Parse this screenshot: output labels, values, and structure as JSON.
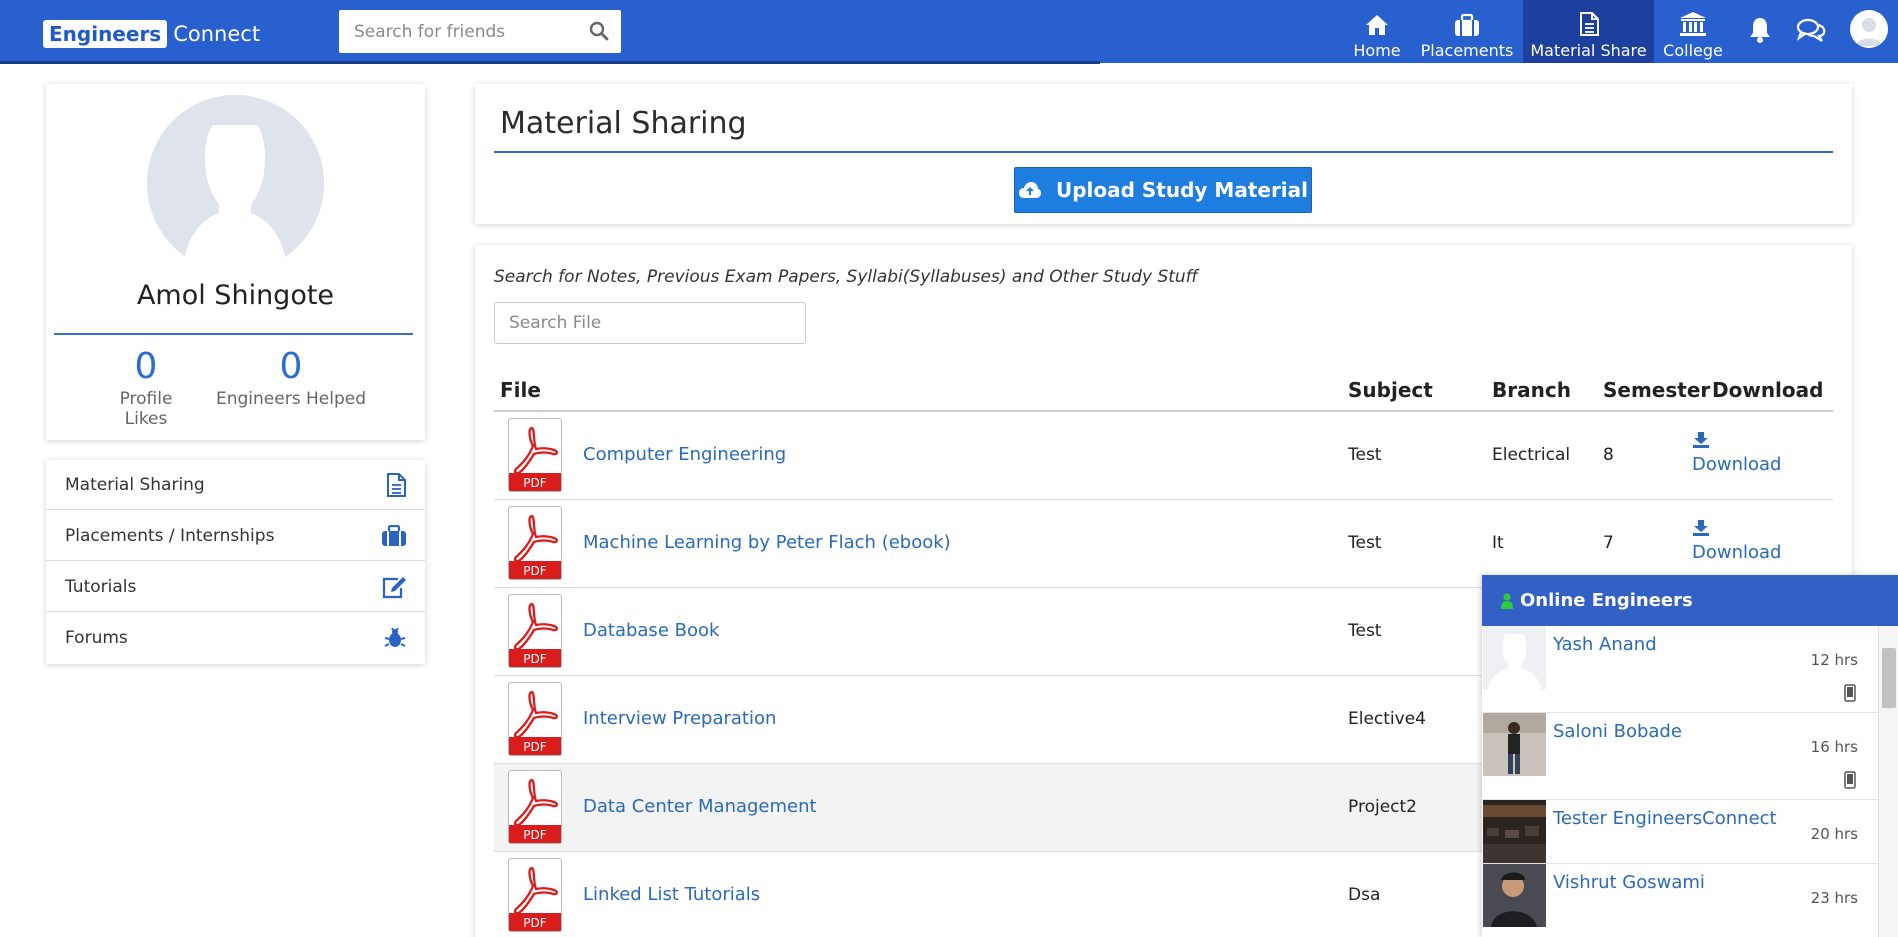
{
  "brand": {
    "box_text": "Engineers",
    "text": "Connect"
  },
  "search": {
    "placeholder": "Search for friends"
  },
  "nav": {
    "items": [
      {
        "label": "Home",
        "icon": "home-icon"
      },
      {
        "label": "Placements",
        "icon": "briefcase-icon"
      },
      {
        "label": "Material Share",
        "icon": "document-icon",
        "active": true
      },
      {
        "label": "College",
        "icon": "college-icon"
      }
    ],
    "icons": [
      "bell-icon",
      "chat-icon",
      "user-avatar"
    ]
  },
  "profile": {
    "name": "Amol Shingote",
    "stats": [
      {
        "value": "0",
        "label": "Profile Likes"
      },
      {
        "value": "0",
        "label": "Engineers Helped"
      }
    ]
  },
  "side_menu": [
    {
      "label": "Material Sharing",
      "icon": "document-icon"
    },
    {
      "label": "Placements / Internships",
      "icon": "briefcase-icon"
    },
    {
      "label": "Tutorials",
      "icon": "edit-icon"
    },
    {
      "label": "Forums",
      "icon": "bug-icon"
    }
  ],
  "material": {
    "title": "Material Sharing",
    "upload_label": "Upload Study Material",
    "search_hint": "Search for Notes, Previous Exam Papers, Syllabi(Syllabuses) and Other Study Stuff",
    "search_placeholder": "Search File",
    "columns": [
      "File",
      "Subject",
      "Branch",
      "Semester",
      "Download"
    ],
    "download_label": "Download",
    "pdf_label": "PDF",
    "rows": [
      {
        "file": "Computer Engineering",
        "subject": "Test",
        "branch": "Electrical",
        "semester": "8",
        "download": "Download"
      },
      {
        "file": "Machine Learning by Peter Flach (ebook)",
        "subject": "Test",
        "branch": "It",
        "semester": "7",
        "download": "Download"
      },
      {
        "file": "Database Book",
        "subject": "Test",
        "branch": "",
        "semester": "",
        "download": ""
      },
      {
        "file": "Interview Preparation",
        "subject": "Elective4",
        "branch": "",
        "semester": "",
        "download": ""
      },
      {
        "file": "Data Center Management",
        "subject": "Project2",
        "branch": "",
        "semester": "",
        "download": ""
      },
      {
        "file": "Linked List Tutorials",
        "subject": "Dsa",
        "branch": "",
        "semester": "",
        "download": ""
      }
    ]
  },
  "online": {
    "title": "Online Engineers",
    "users": [
      {
        "name": "Yash Anand",
        "time": "12 hrs"
      },
      {
        "name": "Saloni Bobade",
        "time": "16 hrs"
      },
      {
        "name": "Tester EngineersConnect",
        "time": "20 hrs"
      },
      {
        "name": "Vishrut Goswami",
        "time": "23 hrs"
      }
    ]
  },
  "colors": {
    "primary": "#2860d0",
    "active_nav": "#1d3f9e",
    "link": "#2a6ab8",
    "upload": "#1e7ee0",
    "pdf_red": "#d91c1c",
    "online_dot": "#2ecc40"
  }
}
